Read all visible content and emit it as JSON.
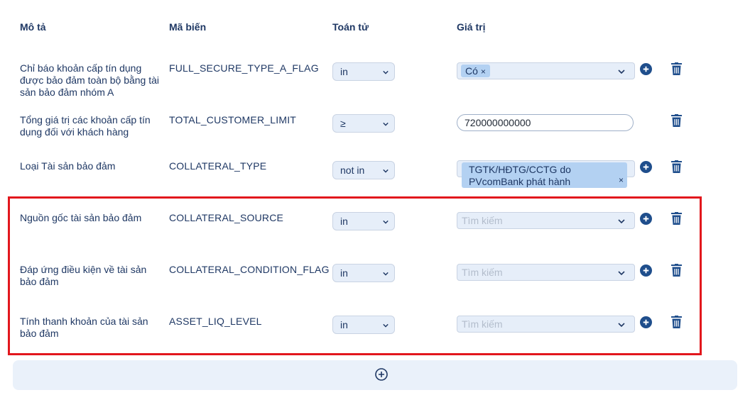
{
  "headers": {
    "description": "Mô tả",
    "variable": "Mã biến",
    "operator": "Toán tử",
    "value": "Giá trị"
  },
  "rows": [
    {
      "description": "Chỉ báo khoản cấp tín dụng được bảo đảm toàn bộ bằng tài sản bảo đảm nhóm A",
      "variable": "FULL_SECURE_TYPE_A_FLAG",
      "operator": "in",
      "value_tag": "Có",
      "tag_remove": "×"
    },
    {
      "description": "Tổng giá trị các khoản cấp tín dụng đối với khách hàng",
      "variable": "TOTAL_CUSTOMER_LIMIT",
      "operator": "≥",
      "value_text": "720000000000"
    },
    {
      "description": "Loại Tài sản bảo đảm",
      "variable": "COLLATERAL_TYPE",
      "operator": "not in",
      "value_tag": "TGTK/HĐTG/CCTG do PVcomBank phát hành",
      "tag_remove": "×"
    },
    {
      "description": "Nguồn gốc tài sản bảo đảm",
      "variable": "COLLATERAL_SOURCE",
      "operator": "in",
      "placeholder": "Tìm kiếm"
    },
    {
      "description": "Đáp ứng điều kiện về tài sản bảo đảm",
      "variable": "COLLATERAL_CONDITION_FLAG",
      "operator": "in",
      "placeholder": "Tìm kiếm"
    },
    {
      "description": "Tính thanh khoản của tài sản bảo đảm",
      "variable": "ASSET_LIQ_LEVEL",
      "operator": "in",
      "placeholder": "Tìm kiếm"
    }
  ],
  "icons": {
    "add_value": "plus-circle-icon",
    "delete_row": "trash-icon",
    "add_condition": "plus-circle-outline-icon",
    "dropdown": "chevron-down-icon"
  },
  "colors": {
    "text": "#1f3864",
    "accent": "#1f4e8c",
    "field_bg": "#e6eef9",
    "tag_bg": "#b3d1f2",
    "highlight": "#e2171d"
  }
}
